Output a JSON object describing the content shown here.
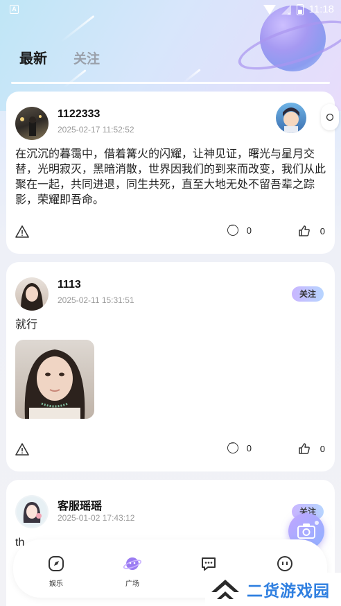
{
  "status_bar": {
    "time": "11:18",
    "left_icon": "A"
  },
  "tabs": [
    {
      "label": "最新",
      "active": true
    },
    {
      "label": "关注",
      "active": false
    }
  ],
  "posts": [
    {
      "username": "1122333",
      "time": "2025-02-17 11:52:52",
      "content": "在沉沉的暮霭中，借着篝火的闪耀，让神见证，曙光与星月交替，光明寂灭，黑暗消散，世界因我们的到来而改变，我们从此聚在一起，共同进退，同生共死，直至大地无处不留吾辈之踪影，荣耀即吾命。",
      "comments": "0",
      "likes": "0"
    },
    {
      "username": "1113",
      "time": "2025-02-11 15:31:51",
      "content": "就行",
      "follow_label": "关注",
      "comments": "0",
      "likes": "0"
    },
    {
      "username": "客服瑶瑶",
      "time": "2025-01-02 17:43:12",
      "content": "th",
      "follow_label": "关注"
    }
  ],
  "bottom_nav": [
    {
      "label": "娱乐",
      "icon": "compass-icon"
    },
    {
      "label": "广场",
      "icon": "planet-icon"
    },
    {
      "label": "",
      "icon": "chat-icon"
    },
    {
      "label": "",
      "icon": "profile-icon"
    }
  ],
  "watermark": {
    "text": "二货游戏园"
  },
  "colors": {
    "accent": "#b9a4ff",
    "watermark": "#2f7fe0"
  }
}
